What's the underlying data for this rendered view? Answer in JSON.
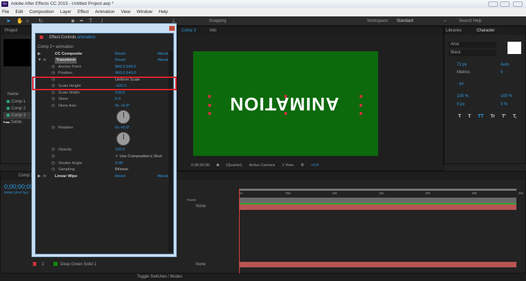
{
  "window": {
    "title": "Adobe After Effects CC 2015 - Untitled Project.aep *",
    "app_icon": "Ae"
  },
  "menu": [
    "File",
    "Edit",
    "Composition",
    "Layer",
    "Effect",
    "Animation",
    "View",
    "Window",
    "Help"
  ],
  "toolbar": {
    "snapping": "Snapping",
    "workspace_label": "Workspace:",
    "workspace_value": "Standard",
    "search_help": "Search Help"
  },
  "project": {
    "tab": "Project",
    "column_name": "Name",
    "items": [
      {
        "name": "Comp 1",
        "type": "comp"
      },
      {
        "name": "Comp 2",
        "type": "comp"
      },
      {
        "name": "Comp 3",
        "type": "comp",
        "selected": true
      },
      {
        "name": "Solids",
        "type": "folder"
      }
    ]
  },
  "effect_controls": {
    "tab": "Effect Controls",
    "layer": "animation",
    "breadcrumb": "Comp 3 • animation",
    "rows": [
      {
        "label": "CC Composite",
        "value": "Reset",
        "about": "About..."
      },
      {
        "label": "Transform",
        "value": "Reset",
        "about": "About..."
      },
      {
        "label": "Anchor Point",
        "value": "960.0,540.0"
      },
      {
        "label": "Position",
        "value": "960.0,540.0"
      },
      {
        "label": "",
        "value": "Uniform Scale"
      },
      {
        "label": "Scale Height",
        "value": "-100.0"
      },
      {
        "label": "Scale Width",
        "value": "100.0"
      },
      {
        "label": "Skew",
        "value": "0.0"
      },
      {
        "label": "Skew Axis",
        "value": "0x +0.0°"
      },
      {
        "label": "Rotation",
        "value": "0x +0.0°"
      },
      {
        "label": "Opacity",
        "value": "100.0"
      },
      {
        "label": "",
        "value": "✓ Use Composition's Shut"
      },
      {
        "label": "Shutter Angle",
        "value": "0.00"
      },
      {
        "label": "Sampling",
        "value": "Bilinear"
      },
      {
        "label": "Linear Wipe",
        "value": "Reset",
        "about": "About..."
      }
    ],
    "highlight_color": "#e0232a"
  },
  "composition": {
    "tabs": [
      "Comp 3",
      "Info"
    ],
    "text": "ANIMATION",
    "bg_color": "#0c6a0c",
    "footer": {
      "timecode": "0;00;00;00",
      "resolution": "(Quarter)",
      "camera": "Active Camera",
      "views": "1 View",
      "exposure": "+0.0"
    }
  },
  "character": {
    "tabs": [
      "Libraries",
      "Character"
    ],
    "font": "Arial",
    "style": "Black",
    "size": "72 px",
    "leading": "Auto",
    "kerning": "Metrics",
    "tracking": "0",
    "stroke": "- px",
    "vscale": "100 %",
    "hscale": "100 %",
    "baseline": "0 px",
    "tsume": "0 %",
    "styles": [
      "T",
      "T",
      "TT",
      "Tr",
      "T'",
      "T,"
    ]
  },
  "timeline": {
    "tab": "Comp 3",
    "timecode": "0;00;00;00",
    "fps": "00000 (29.97 fps)",
    "ruler": [
      "0s",
      "05s",
      "10s",
      "15s",
      "20s",
      "25s",
      "30s"
    ],
    "parent_header": "Parent",
    "parent_value": "None",
    "layers": [
      {
        "index": "2",
        "name": "Deep Green Solid 1",
        "color": "#c8333a",
        "parent": "None"
      }
    ],
    "toggle": "Toggle Switches / Modes"
  }
}
